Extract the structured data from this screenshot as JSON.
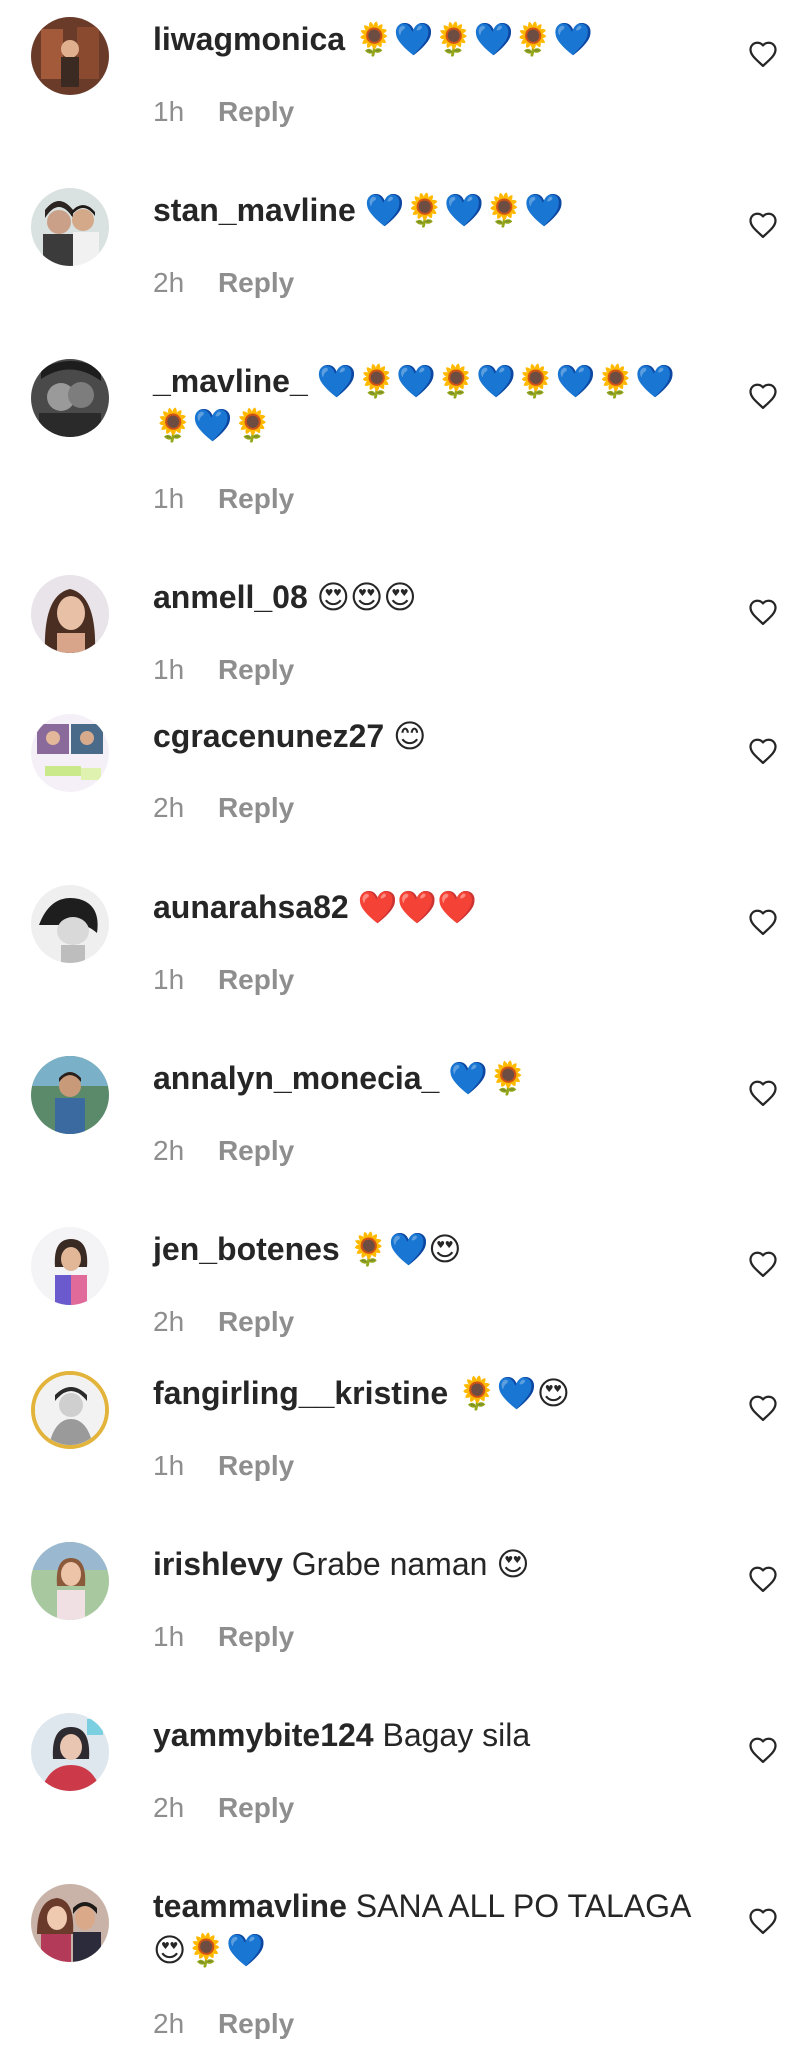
{
  "comments": [
    {
      "username": "liwagmonica",
      "text": "🌻💙🌻💙🌻💙",
      "time": "1h",
      "reply": "Reply"
    },
    {
      "username": "stan_mavline",
      "text": "💙🌻💙🌻💙",
      "time": "2h",
      "reply": "Reply"
    },
    {
      "username": "_mavline_",
      "text": "💙🌻💙🌻💙🌻💙🌻💙🌻💙🌻",
      "time": "1h",
      "reply": "Reply"
    },
    {
      "username": "anmell_08",
      "text": "😍😍😍",
      "time": "1h",
      "reply": "Reply"
    },
    {
      "username": "cgracenunez27",
      "text": "😊",
      "time": "2h",
      "reply": "Reply"
    },
    {
      "username": "aunarahsa82",
      "text": "❤️❤️❤️",
      "time": "1h",
      "reply": "Reply"
    },
    {
      "username": "annalyn_monecia_",
      "text": "💙🌻",
      "time": "2h",
      "reply": "Reply"
    },
    {
      "username": "jen_botenes",
      "text": "🌻💙😍",
      "time": "2h",
      "reply": "Reply"
    },
    {
      "username": "fangirling__kristine",
      "text": "🌻💙😍",
      "time": "1h",
      "reply": "Reply"
    },
    {
      "username": "irishlevy",
      "text": "Grabe naman 😍",
      "time": "1h",
      "reply": "Reply"
    },
    {
      "username": "yammybite124",
      "text": "Bagay sila",
      "time": "2h",
      "reply": "Reply"
    },
    {
      "username": "teammavline",
      "text": "SANA ALL PO TALAGA 😍🌻💙",
      "time": "2h",
      "reply": "Reply"
    }
  ],
  "icons": {
    "like": "heart-outline-icon"
  },
  "colors": {
    "username": "#262626",
    "meta": "#8e8e8e",
    "story_ring": "#e3b43c"
  }
}
